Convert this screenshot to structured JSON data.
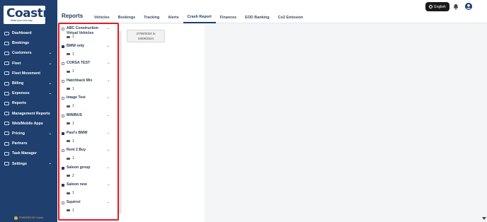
{
  "brand": {
    "logo_text": "Coastr",
    "tagline": "Make your own way",
    "powered_by": "POWERED BY Coastr"
  },
  "sidebar": {
    "items": [
      {
        "label": "Dashboard",
        "chevron": false
      },
      {
        "label": "Bookings",
        "chevron": false
      },
      {
        "label": "Customers",
        "chevron": true
      },
      {
        "label": "Fleet",
        "chevron": true
      },
      {
        "label": "Fleet Movement",
        "chevron": false
      },
      {
        "label": "Billing",
        "chevron": true
      },
      {
        "label": "Expenses",
        "chevron": true
      },
      {
        "label": "Reports",
        "chevron": false
      },
      {
        "label": "Management Reports",
        "chevron": false
      },
      {
        "label": "Web/Mobile Apps",
        "chevron": false
      },
      {
        "label": "Pricing",
        "chevron": true
      },
      {
        "label": "Partners",
        "chevron": false
      },
      {
        "label": "Task Manager",
        "chevron": false
      },
      {
        "label": "Settings",
        "chevron": true
      }
    ]
  },
  "header": {
    "title": "Reports",
    "tabs": [
      "Vehicles",
      "Bookings",
      "Tracking",
      "Alerts",
      "Crash Report",
      "Finances",
      "EOD Banking",
      "Co2 Emission"
    ],
    "active_tab": "Crash Report",
    "language": "English"
  },
  "groups": [
    {
      "name": "ABC Construction Virtual Vehicles",
      "count": "1",
      "checked": false
    },
    {
      "name": "BMW only",
      "count": "1",
      "checked": true
    },
    {
      "name": "CORSA TEST",
      "count": "1",
      "checked": false
    },
    {
      "name": "Hatchback Mix",
      "count": "1",
      "checked": false
    },
    {
      "name": "Image Test",
      "count": "1",
      "checked": false
    },
    {
      "name": "MINIBUS",
      "count": "1",
      "checked": false
    },
    {
      "name": "Paul's BMW",
      "count": "1",
      "checked": true
    },
    {
      "name": "Rent 2 Buy",
      "count": "1",
      "checked": false
    },
    {
      "name": "Saloon group",
      "count": "2",
      "checked": true
    },
    {
      "name": "Saloon new",
      "count": "1",
      "checked": true
    },
    {
      "name": "Squirrel",
      "count": "1",
      "checked": false
    }
  ],
  "date_range": {
    "line1": "27/08/2024 to",
    "line2": "03/09/2024"
  },
  "colors": {
    "sidebar": "#1f3f6e",
    "highlight": "#e01b24"
  }
}
